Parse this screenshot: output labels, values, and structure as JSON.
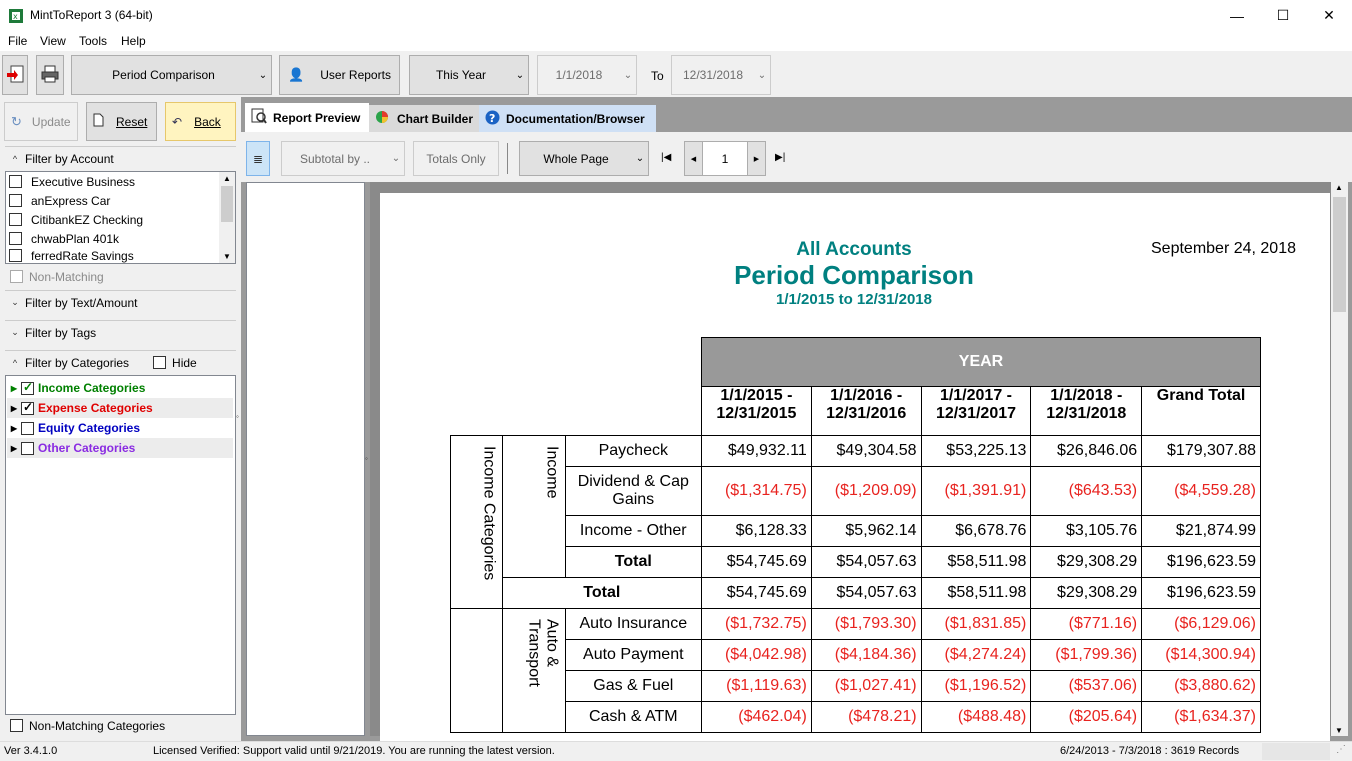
{
  "window": {
    "title": "MintToReport 3 (64-bit)",
    "minimize": "—",
    "maximize": "☐",
    "close": "✕"
  },
  "menu": [
    "File",
    "View",
    "Tools",
    "Help"
  ],
  "toolbar": {
    "report_type": "Period Comparison",
    "user_reports": "User Reports",
    "period": "This Year",
    "date_from": "1/1/2018",
    "to_label": "To",
    "date_to": "12/31/2018"
  },
  "side_buttons": {
    "update": "Update",
    "reset": "Reset",
    "back": "Back"
  },
  "filter_account": {
    "header": "Filter by Account",
    "accounts": [
      "Executive Business",
      "anExpress Car",
      "CitibankEZ Checking",
      "chwabPlan 401k",
      "ferredRate Savings"
    ],
    "non_matching": "Non-Matching"
  },
  "filter_text": "Filter by Text/Amount",
  "filter_tags": "Filter by Tags",
  "filter_categories": {
    "header": "Filter by Categories",
    "hide_label": "Hide",
    "items": [
      {
        "label": "Income Categories",
        "checked": true,
        "color": "#008000"
      },
      {
        "label": "Expense Categories",
        "checked": true,
        "color": "#e00000"
      },
      {
        "label": "Equity Categories",
        "checked": false,
        "color": "#0000c0"
      },
      {
        "label": "Other Categories",
        "checked": false,
        "color": "#8a2be2"
      }
    ],
    "non_matching": "Non-Matching Categories"
  },
  "tabs": [
    "Report Preview",
    "Chart Builder",
    "Documentation/Browser"
  ],
  "report_toolbar": {
    "subtotal": "Subtotal by ..",
    "totals_only": "Totals Only",
    "zoom": "Whole Page",
    "page": "1"
  },
  "report": {
    "account_title": "All Accounts",
    "title": "Period Comparison",
    "range": "1/1/2015 to 12/31/2018",
    "date": "September 24, 2018",
    "group_header": "YEAR",
    "columns": [
      "1/1/2015 - 12/31/2015",
      "1/1/2016 - 12/31/2016",
      "1/1/2017 - 12/31/2017",
      "1/1/2018 - 12/31/2018",
      "Grand Total"
    ],
    "income_group": "Income Categories",
    "income_sub": "Income",
    "income_rows": [
      {
        "label": "Paycheck",
        "values": [
          "$49,932.11",
          "$49,304.58",
          "$53,225.13",
          "$26,846.06",
          "$179,307.88"
        ]
      },
      {
        "label": "Dividend & Cap Gains",
        "values": [
          "($1,314.75)",
          "($1,209.09)",
          "($1,391.91)",
          "($643.53)",
          "($4,559.28)"
        ]
      },
      {
        "label": "Income - Other",
        "values": [
          "$6,128.33",
          "$5,962.14",
          "$6,678.76",
          "$3,105.76",
          "$21,874.99"
        ]
      }
    ],
    "total_label": "Total",
    "income_total": [
      "$54,745.69",
      "$54,057.63",
      "$58,511.98",
      "$29,308.29",
      "$196,623.59"
    ],
    "group_total": [
      "$54,745.69",
      "$54,057.63",
      "$58,511.98",
      "$29,308.29",
      "$196,623.59"
    ],
    "auto_sub": "Auto & Transport",
    "auto_rows": [
      {
        "label": "Auto Insurance",
        "values": [
          "($1,732.75)",
          "($1,793.30)",
          "($1,831.85)",
          "($771.16)",
          "($6,129.06)"
        ]
      },
      {
        "label": "Auto Payment",
        "values": [
          "($4,042.98)",
          "($4,184.36)",
          "($4,274.24)",
          "($1,799.36)",
          "($14,300.94)"
        ]
      },
      {
        "label": "Gas & Fuel",
        "values": [
          "($1,119.63)",
          "($1,027.41)",
          "($1,196.52)",
          "($537.06)",
          "($3,880.62)"
        ]
      },
      {
        "label": "Cash & ATM",
        "values": [
          "($462.04)",
          "($478.21)",
          "($488.48)",
          "($205.64)",
          "($1,634.37)"
        ]
      }
    ]
  },
  "status": {
    "version": "Ver 3.4.1.0",
    "license": "Licensed Verified: Support valid until 9/21/2019. You are running the latest version.",
    "records": "6/24/2013 - 7/3/2018 : 3619 Records"
  }
}
